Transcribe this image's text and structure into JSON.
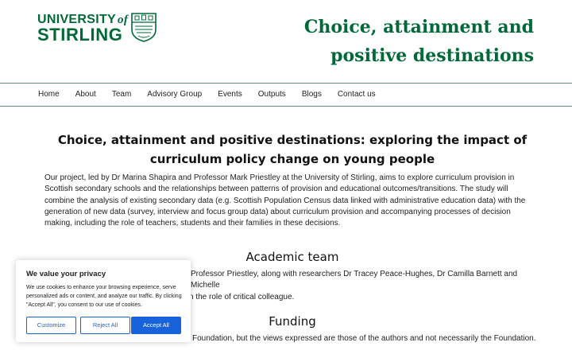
{
  "logo": {
    "line1": "UNIVERSITY",
    "of": "of",
    "line2": "STIRLING"
  },
  "site_title": "Choice, attainment and positive destinations",
  "nav": {
    "items": [
      "Home",
      "About",
      "Team",
      "Advisory Group",
      "Events",
      "Outputs",
      "Blogs",
      "Contact us"
    ]
  },
  "main": {
    "heading": "Choice, attainment and positive destinations: exploring the impact of curriculum policy change on young people",
    "intro": "Our project, led by Dr Marina Shapira and Professor Mark Priestley at the University of Stirling, aims to explore curriculum provision in Scottish secondary schools and the relationships between patterns of provision and educational outcomes/transitions. The study will combine the analysis of existing secondary data (e.g. Scottish Population Census data linked with administrative education data) with the generation of new data (survey, interview and focus group data) about curriculum provision and accompanying processes of decision making, including the role of teachers, students and their families in these decisions."
  },
  "academic": {
    "heading": "Academic team",
    "line1": "Professor Priestley, along with researchers Dr Tracey Peace-Hughes, Dr Camilla Barnett and Michelle",
    "line2": "n the role of critical colleague."
  },
  "funding": {
    "heading": "Funding",
    "text": "Foundation, but the views expressed are those of the authors and not necessarily the Foundation."
  },
  "cookie": {
    "title": "We value your privacy",
    "text": "We use cookies to enhance your browsing experience, serve personalized ads or content, and analyze our traffic. By clicking \"Accept All\", you consent to our use of cookies.",
    "customize": "Customize",
    "reject": "Reject All",
    "accept": "Accept All"
  },
  "colors": {
    "brand_green": "#006938",
    "cookie_blue": "#1863dc"
  }
}
